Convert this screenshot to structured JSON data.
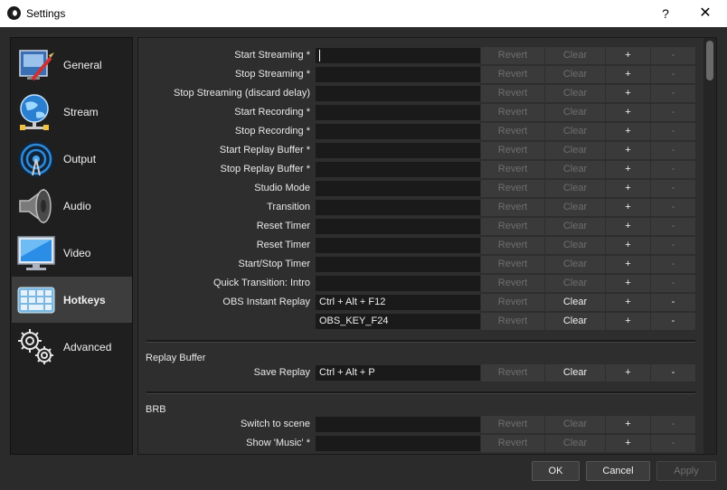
{
  "window": {
    "title": "Settings",
    "help_label": "?",
    "close_label": "✕"
  },
  "sidebar": {
    "items": [
      {
        "label": "General",
        "icon": "general-icon"
      },
      {
        "label": "Stream",
        "icon": "stream-globe-icon"
      },
      {
        "label": "Output",
        "icon": "output-broadcast-icon"
      },
      {
        "label": "Audio",
        "icon": "audio-speaker-icon"
      },
      {
        "label": "Video",
        "icon": "video-monitor-icon"
      },
      {
        "label": "Hotkeys",
        "icon": "hotkeys-keyboard-icon",
        "active": true
      },
      {
        "label": "Advanced",
        "icon": "advanced-gears-icon"
      }
    ]
  },
  "buttons": {
    "revert": "Revert",
    "clear": "Clear",
    "add": "+",
    "remove": "-"
  },
  "hotkeys": [
    {
      "label": "Start Streaming *",
      "value": ""
    },
    {
      "label": "Stop Streaming *",
      "value": ""
    },
    {
      "label": "Stop Streaming (discard delay)",
      "value": ""
    },
    {
      "label": "Start Recording *",
      "value": ""
    },
    {
      "label": "Stop Recording *",
      "value": ""
    },
    {
      "label": "Start Replay Buffer *",
      "value": ""
    },
    {
      "label": "Stop Replay Buffer *",
      "value": ""
    },
    {
      "label": "Studio Mode",
      "value": ""
    },
    {
      "label": "Transition",
      "value": ""
    },
    {
      "label": "Reset Timer",
      "value": ""
    },
    {
      "label": "Reset Timer",
      "value": ""
    },
    {
      "label": "Start/Stop Timer",
      "value": ""
    },
    {
      "label": "Quick Transition: Intro",
      "value": ""
    },
    {
      "label": "OBS Instant Replay",
      "value": "Ctrl + Alt + F12"
    },
    {
      "label": "",
      "value": "OBS_KEY_F24"
    }
  ],
  "sections": [
    {
      "title": "Replay Buffer",
      "rows": [
        {
          "label": "Save Replay",
          "value": "Ctrl + Alt + P"
        }
      ]
    },
    {
      "title": "BRB",
      "rows": [
        {
          "label": "Switch to scene",
          "value": ""
        },
        {
          "label": "Show 'Music' *",
          "value": ""
        }
      ]
    }
  ],
  "footer": {
    "ok": "OK",
    "cancel": "Cancel",
    "apply": "Apply"
  }
}
